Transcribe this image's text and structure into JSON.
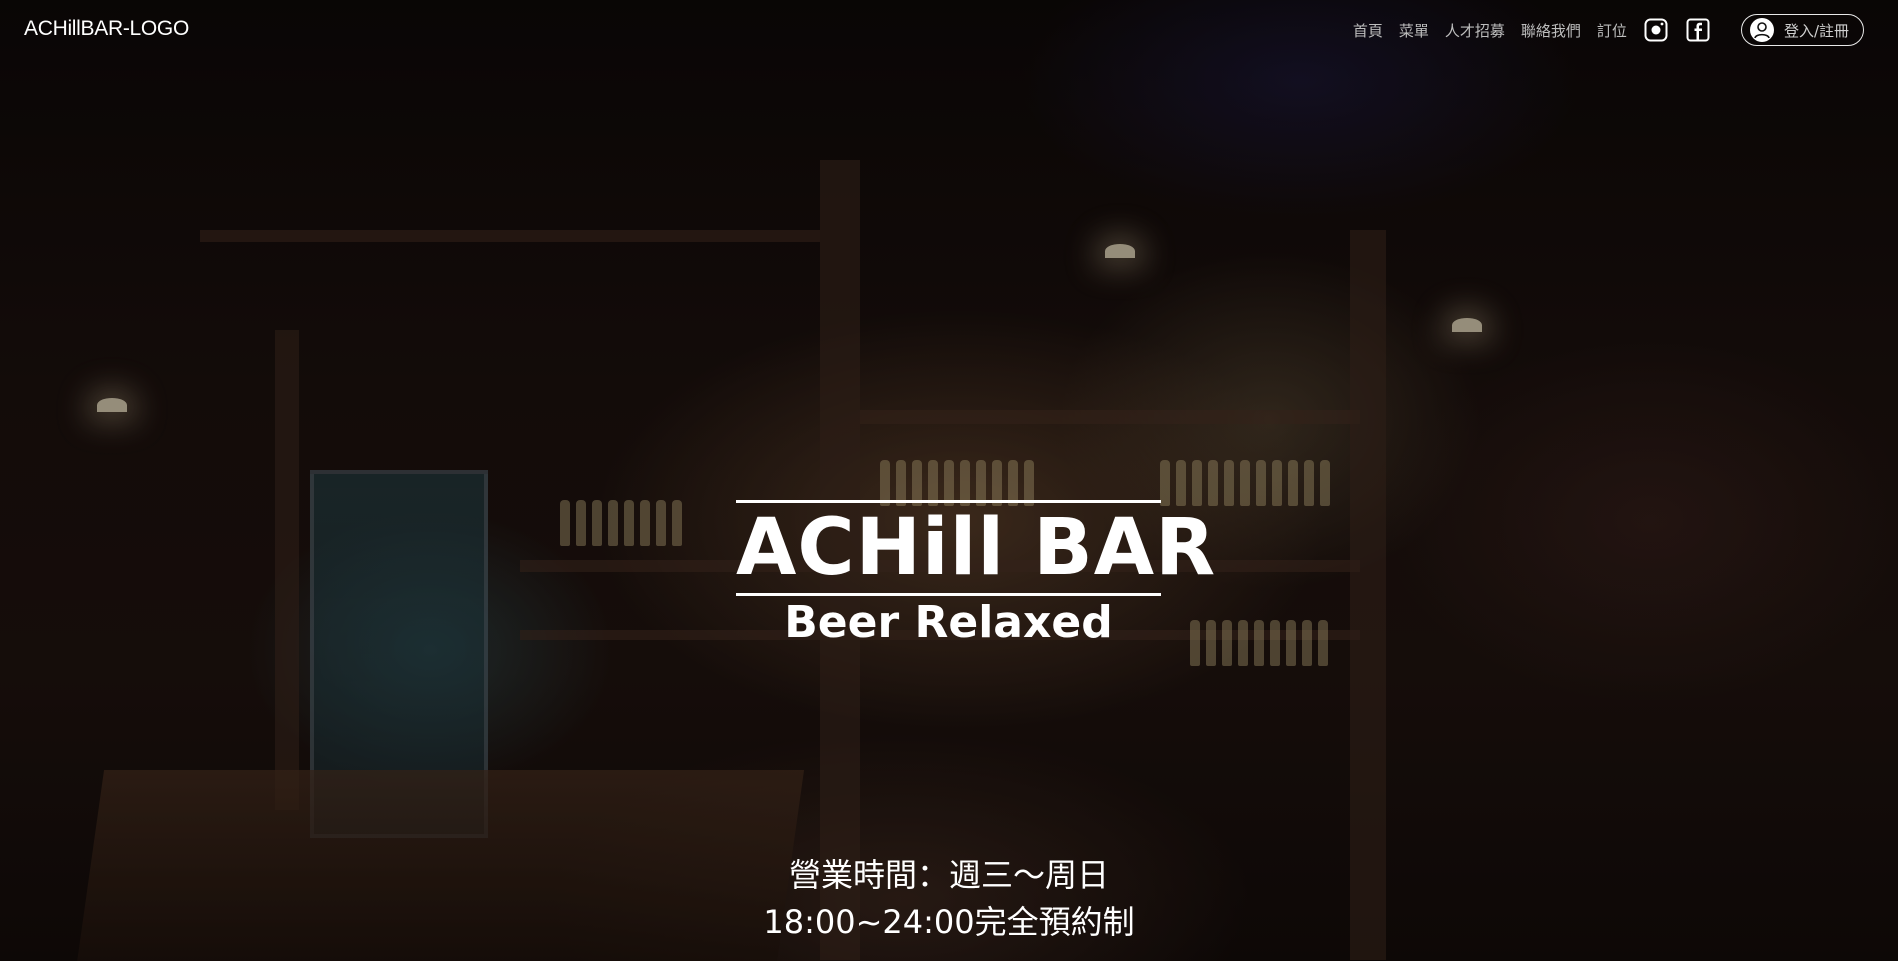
{
  "header": {
    "logo_text": "ACHillBAR-LOGO",
    "nav_items": [
      {
        "label": "首頁"
      },
      {
        "label": "菜單"
      },
      {
        "label": "人才招募"
      },
      {
        "label": "聯絡我們"
      },
      {
        "label": "訂位"
      }
    ],
    "social": [
      {
        "icon": "instagram-icon"
      },
      {
        "icon": "facebook-icon"
      }
    ],
    "login": {
      "icon": "user-avatar-icon",
      "label": "登入/註冊"
    }
  },
  "hero": {
    "title": "ACHill BAR",
    "subtitle": "Beer Relaxed",
    "hours_line1": "營業時間：週三～周日",
    "hours_line2": "18:00~24:00完全預約制"
  },
  "colors": {
    "text": "#ffffff",
    "nav_text": "#bdbdbd",
    "background": "#0b0706"
  }
}
